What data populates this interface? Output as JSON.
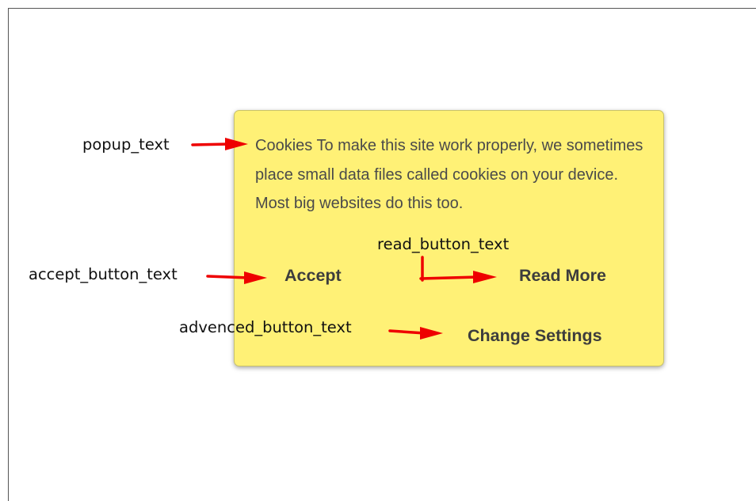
{
  "colors": {
    "popup_background": "#fff176",
    "annotation_arrow": "#ee0000"
  },
  "popup": {
    "message": "Cookies To make this site work properly, we sometimes place small data files called cookies on your device. Most big websites do this too.",
    "accept_label": "Accept",
    "read_more_label": "Read More",
    "change_settings_label": "Change Settings"
  },
  "annotations": {
    "popup_text": "popup_text",
    "accept_button_text": "accept_button_text",
    "read_button_text": "read_button_text",
    "advanced_button_text": "advenced_button_text"
  }
}
